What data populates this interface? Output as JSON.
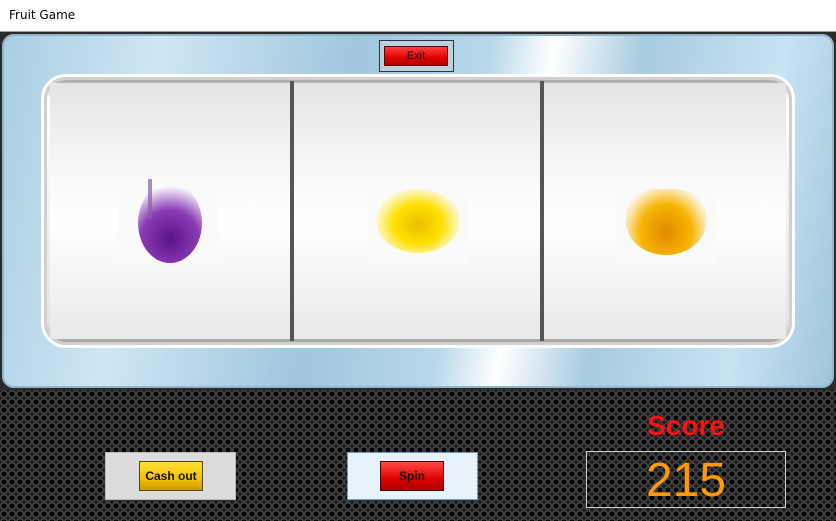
{
  "window": {
    "title": "Fruit Game"
  },
  "machine": {
    "exit_label": "Exit"
  },
  "reels": [
    {
      "fruit": "plum",
      "color": "#7a2aa0"
    },
    {
      "fruit": "lemon",
      "color": "#f5d000"
    },
    {
      "fruit": "orange-slice",
      "color": "#f3a800"
    }
  ],
  "controls": {
    "cash_out_label": "Cash out",
    "spin_label": "Spin"
  },
  "score": {
    "label": "Score",
    "value": "215",
    "label_color": "#ff1010",
    "value_color": "#ff9a00"
  }
}
